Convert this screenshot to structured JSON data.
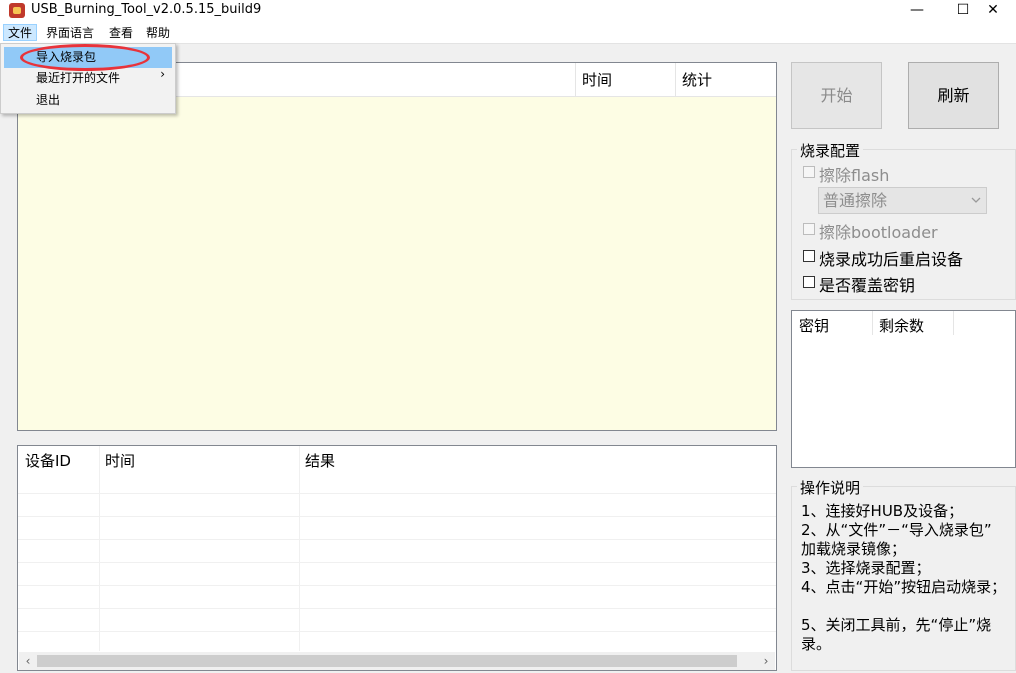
{
  "window": {
    "title": "USB_Burning_Tool_v2.0.5.15_build9",
    "minimize_glyph": "—",
    "maximize_glyph": "☐",
    "close_glyph": "✕"
  },
  "menubar": {
    "file": "文件",
    "language": "界面语言",
    "view": "查看",
    "help": "帮助"
  },
  "file_menu": {
    "import": "导入烧录包",
    "recent": "最近打开的文件",
    "recent_arrow": "›",
    "exit": "退出"
  },
  "main_list": {
    "columns": [
      "时间",
      "统计"
    ]
  },
  "result_table": {
    "columns": [
      "设备ID",
      "时间",
      "结果"
    ],
    "scroll_left": "‹",
    "scroll_right": "›"
  },
  "buttons": {
    "start": "开始",
    "refresh": "刷新"
  },
  "burn_config": {
    "title": "烧录配置",
    "erase_flash": "擦除flash",
    "erase_mode": "普通擦除",
    "erase_bootloader": "擦除bootloader",
    "reboot_after": "烧录成功后重启设备",
    "overwrite_key": "是否覆盖密钥"
  },
  "key_list": {
    "columns": [
      "密钥",
      "剩余数"
    ]
  },
  "instructions": {
    "title": "操作说明",
    "lines": [
      "1、连接好HUB及设备；",
      "2、从“文件”－“导入烧录包” 加载烧录镜像；",
      "3、选择烧录配置；",
      "4、点击“开始”按钮启动烧录；",
      "5、关闭工具前，先“停止”烧录。"
    ]
  },
  "colors": {
    "highlight": "#e8333a",
    "list_bg": "#fdfde4",
    "menu_selected": "#91c9f7"
  }
}
